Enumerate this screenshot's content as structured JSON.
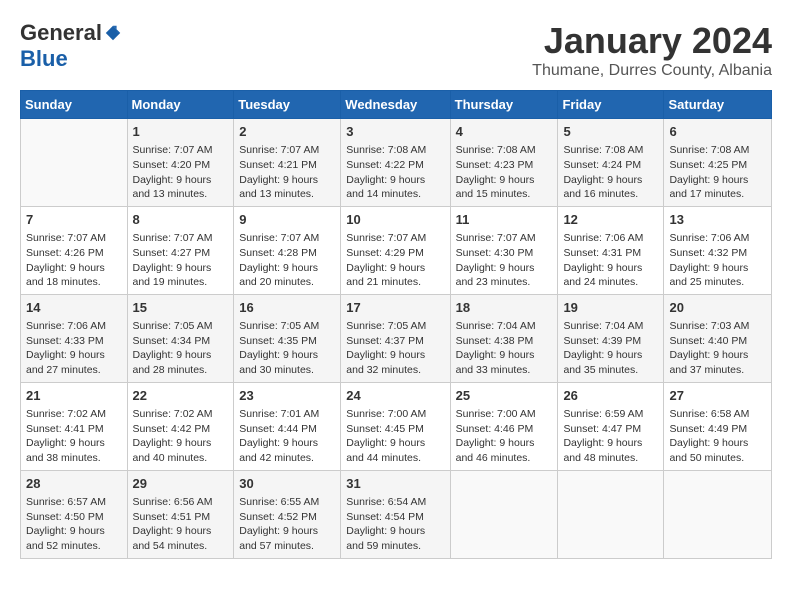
{
  "logo": {
    "general": "General",
    "blue": "Blue"
  },
  "title": {
    "month_year": "January 2024",
    "location": "Thumane, Durres County, Albania"
  },
  "headers": [
    "Sunday",
    "Monday",
    "Tuesday",
    "Wednesday",
    "Thursday",
    "Friday",
    "Saturday"
  ],
  "weeks": [
    [
      {
        "day": "",
        "sunrise": "",
        "sunset": "",
        "daylight": ""
      },
      {
        "day": "1",
        "sunrise": "Sunrise: 7:07 AM",
        "sunset": "Sunset: 4:20 PM",
        "daylight": "Daylight: 9 hours and 13 minutes."
      },
      {
        "day": "2",
        "sunrise": "Sunrise: 7:07 AM",
        "sunset": "Sunset: 4:21 PM",
        "daylight": "Daylight: 9 hours and 13 minutes."
      },
      {
        "day": "3",
        "sunrise": "Sunrise: 7:08 AM",
        "sunset": "Sunset: 4:22 PM",
        "daylight": "Daylight: 9 hours and 14 minutes."
      },
      {
        "day": "4",
        "sunrise": "Sunrise: 7:08 AM",
        "sunset": "Sunset: 4:23 PM",
        "daylight": "Daylight: 9 hours and 15 minutes."
      },
      {
        "day": "5",
        "sunrise": "Sunrise: 7:08 AM",
        "sunset": "Sunset: 4:24 PM",
        "daylight": "Daylight: 9 hours and 16 minutes."
      },
      {
        "day": "6",
        "sunrise": "Sunrise: 7:08 AM",
        "sunset": "Sunset: 4:25 PM",
        "daylight": "Daylight: 9 hours and 17 minutes."
      }
    ],
    [
      {
        "day": "7",
        "sunrise": "Sunrise: 7:07 AM",
        "sunset": "Sunset: 4:26 PM",
        "daylight": "Daylight: 9 hours and 18 minutes."
      },
      {
        "day": "8",
        "sunrise": "Sunrise: 7:07 AM",
        "sunset": "Sunset: 4:27 PM",
        "daylight": "Daylight: 9 hours and 19 minutes."
      },
      {
        "day": "9",
        "sunrise": "Sunrise: 7:07 AM",
        "sunset": "Sunset: 4:28 PM",
        "daylight": "Daylight: 9 hours and 20 minutes."
      },
      {
        "day": "10",
        "sunrise": "Sunrise: 7:07 AM",
        "sunset": "Sunset: 4:29 PM",
        "daylight": "Daylight: 9 hours and 21 minutes."
      },
      {
        "day": "11",
        "sunrise": "Sunrise: 7:07 AM",
        "sunset": "Sunset: 4:30 PM",
        "daylight": "Daylight: 9 hours and 23 minutes."
      },
      {
        "day": "12",
        "sunrise": "Sunrise: 7:06 AM",
        "sunset": "Sunset: 4:31 PM",
        "daylight": "Daylight: 9 hours and 24 minutes."
      },
      {
        "day": "13",
        "sunrise": "Sunrise: 7:06 AM",
        "sunset": "Sunset: 4:32 PM",
        "daylight": "Daylight: 9 hours and 25 minutes."
      }
    ],
    [
      {
        "day": "14",
        "sunrise": "Sunrise: 7:06 AM",
        "sunset": "Sunset: 4:33 PM",
        "daylight": "Daylight: 9 hours and 27 minutes."
      },
      {
        "day": "15",
        "sunrise": "Sunrise: 7:05 AM",
        "sunset": "Sunset: 4:34 PM",
        "daylight": "Daylight: 9 hours and 28 minutes."
      },
      {
        "day": "16",
        "sunrise": "Sunrise: 7:05 AM",
        "sunset": "Sunset: 4:35 PM",
        "daylight": "Daylight: 9 hours and 30 minutes."
      },
      {
        "day": "17",
        "sunrise": "Sunrise: 7:05 AM",
        "sunset": "Sunset: 4:37 PM",
        "daylight": "Daylight: 9 hours and 32 minutes."
      },
      {
        "day": "18",
        "sunrise": "Sunrise: 7:04 AM",
        "sunset": "Sunset: 4:38 PM",
        "daylight": "Daylight: 9 hours and 33 minutes."
      },
      {
        "day": "19",
        "sunrise": "Sunrise: 7:04 AM",
        "sunset": "Sunset: 4:39 PM",
        "daylight": "Daylight: 9 hours and 35 minutes."
      },
      {
        "day": "20",
        "sunrise": "Sunrise: 7:03 AM",
        "sunset": "Sunset: 4:40 PM",
        "daylight": "Daylight: 9 hours and 37 minutes."
      }
    ],
    [
      {
        "day": "21",
        "sunrise": "Sunrise: 7:02 AM",
        "sunset": "Sunset: 4:41 PM",
        "daylight": "Daylight: 9 hours and 38 minutes."
      },
      {
        "day": "22",
        "sunrise": "Sunrise: 7:02 AM",
        "sunset": "Sunset: 4:42 PM",
        "daylight": "Daylight: 9 hours and 40 minutes."
      },
      {
        "day": "23",
        "sunrise": "Sunrise: 7:01 AM",
        "sunset": "Sunset: 4:44 PM",
        "daylight": "Daylight: 9 hours and 42 minutes."
      },
      {
        "day": "24",
        "sunrise": "Sunrise: 7:00 AM",
        "sunset": "Sunset: 4:45 PM",
        "daylight": "Daylight: 9 hours and 44 minutes."
      },
      {
        "day": "25",
        "sunrise": "Sunrise: 7:00 AM",
        "sunset": "Sunset: 4:46 PM",
        "daylight": "Daylight: 9 hours and 46 minutes."
      },
      {
        "day": "26",
        "sunrise": "Sunrise: 6:59 AM",
        "sunset": "Sunset: 4:47 PM",
        "daylight": "Daylight: 9 hours and 48 minutes."
      },
      {
        "day": "27",
        "sunrise": "Sunrise: 6:58 AM",
        "sunset": "Sunset: 4:49 PM",
        "daylight": "Daylight: 9 hours and 50 minutes."
      }
    ],
    [
      {
        "day": "28",
        "sunrise": "Sunrise: 6:57 AM",
        "sunset": "Sunset: 4:50 PM",
        "daylight": "Daylight: 9 hours and 52 minutes."
      },
      {
        "day": "29",
        "sunrise": "Sunrise: 6:56 AM",
        "sunset": "Sunset: 4:51 PM",
        "daylight": "Daylight: 9 hours and 54 minutes."
      },
      {
        "day": "30",
        "sunrise": "Sunrise: 6:55 AM",
        "sunset": "Sunset: 4:52 PM",
        "daylight": "Daylight: 9 hours and 57 minutes."
      },
      {
        "day": "31",
        "sunrise": "Sunrise: 6:54 AM",
        "sunset": "Sunset: 4:54 PM",
        "daylight": "Daylight: 9 hours and 59 minutes."
      },
      {
        "day": "",
        "sunrise": "",
        "sunset": "",
        "daylight": ""
      },
      {
        "day": "",
        "sunrise": "",
        "sunset": "",
        "daylight": ""
      },
      {
        "day": "",
        "sunrise": "",
        "sunset": "",
        "daylight": ""
      }
    ]
  ]
}
